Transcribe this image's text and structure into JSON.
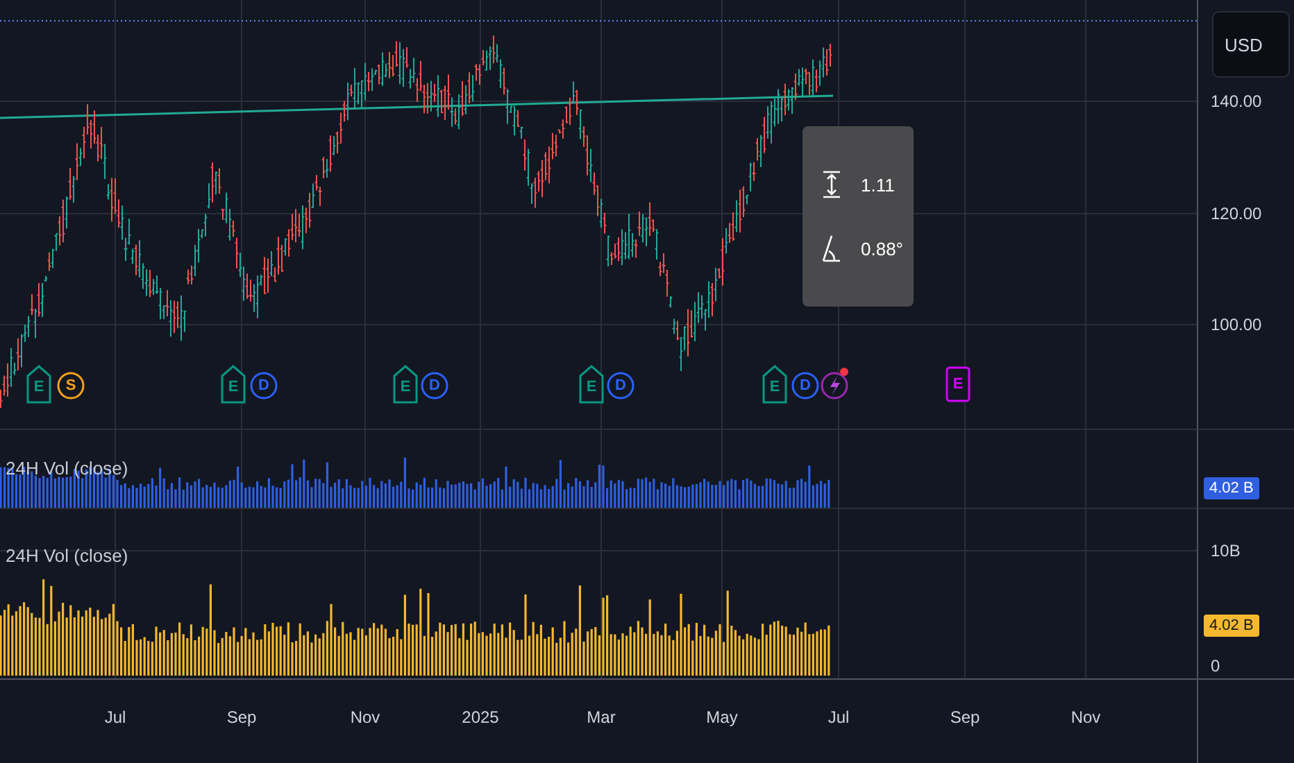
{
  "price_axis": {
    "currency_button": "USD",
    "labels": [
      "140.00",
      "120.00",
      "100.00"
    ]
  },
  "measure_tooltip": {
    "rows": [
      {
        "kind": "range",
        "value": "1.11"
      },
      {
        "kind": "angle",
        "value": "0.88°"
      }
    ]
  },
  "event_markers": [
    {
      "kind": "earnings",
      "label": "E"
    },
    {
      "kind": "split",
      "label": "S"
    },
    {
      "kind": "earnings",
      "label": "E"
    },
    {
      "kind": "dividend",
      "label": "D"
    },
    {
      "kind": "earnings",
      "label": "E"
    },
    {
      "kind": "dividend",
      "label": "D"
    },
    {
      "kind": "earnings",
      "label": "E"
    },
    {
      "kind": "dividend",
      "label": "D"
    },
    {
      "kind": "earnings",
      "label": "E"
    },
    {
      "kind": "dividend",
      "label": "D"
    },
    {
      "kind": "news"
    },
    {
      "kind": "upcoming",
      "label": "E"
    }
  ],
  "volume_panes": [
    {
      "title": "24H Vol (close)",
      "badge": "4.02 B",
      "color": "#2f5fe0"
    },
    {
      "title": "24H Vol (close)",
      "badge": "4.02 B",
      "color": "#f5b82e",
      "axis_labels": [
        "10B",
        "0"
      ]
    }
  ],
  "time_axis": [
    "Jul",
    "Sep",
    "Nov",
    "2025",
    "Mar",
    "May",
    "Jul",
    "Sep",
    "Nov"
  ]
}
